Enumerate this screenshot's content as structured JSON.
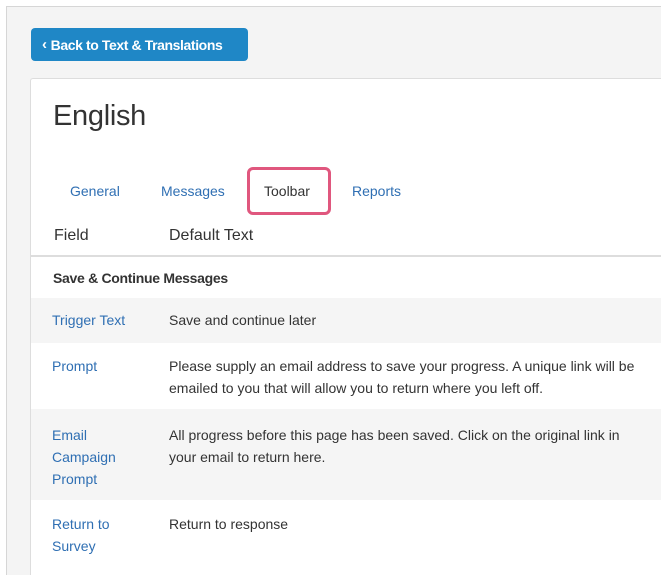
{
  "back_button": {
    "label": "Back to Text & Translations"
  },
  "panel": {
    "title": "English",
    "tabs": [
      {
        "label": "General"
      },
      {
        "label": "Messages"
      },
      {
        "label": "Toolbar"
      },
      {
        "label": "Reports"
      }
    ],
    "active_tab": "Toolbar",
    "columns": {
      "field": "Field",
      "default_text": "Default Text"
    },
    "section_title": "Save & Continue Messages",
    "rows": [
      {
        "field": "Trigger Text",
        "text": "Save and continue later"
      },
      {
        "field": "Prompt",
        "text": "Please supply an email address to save your progress. A unique link will be emailed to you that will allow you to return where you left off."
      },
      {
        "field": "Email Campaign Prompt",
        "text": "All progress before this page has been saved. Click on the original link in your email to return here."
      },
      {
        "field": "Return to Survey",
        "text": "Return to response"
      }
    ]
  },
  "colors": {
    "accent": "#1f87c6",
    "link": "#2f6fb3",
    "highlight": "#e0577e"
  }
}
